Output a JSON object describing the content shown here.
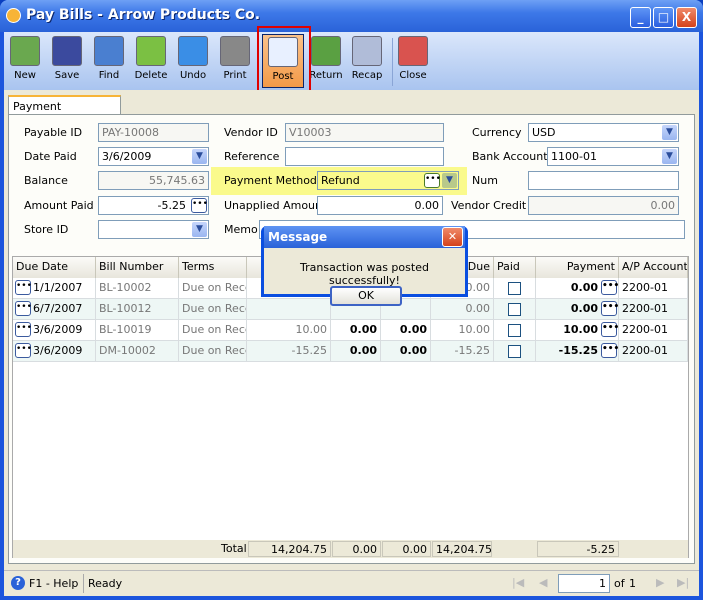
{
  "window": {
    "title": "Pay Bills - Arrow Products Co.",
    "controls": [
      "_",
      "□",
      "X"
    ]
  },
  "toolbar": [
    {
      "label": "New",
      "icon": "new-icon"
    },
    {
      "label": "Save",
      "icon": "save-icon"
    },
    {
      "label": "Find",
      "icon": "find-icon"
    },
    {
      "label": "Delete",
      "icon": "delete-icon"
    },
    {
      "label": "Undo",
      "icon": "undo-icon"
    },
    {
      "label": "Print",
      "icon": "print-icon"
    },
    {
      "label": "Post",
      "icon": "post-icon",
      "active": true
    },
    {
      "label": "Return",
      "icon": "return-icon"
    },
    {
      "label": "Recap",
      "icon": "recap-icon"
    },
    {
      "label": "Close",
      "icon": "close-icon"
    }
  ],
  "tab": "Payment Information",
  "form": {
    "payable_id": {
      "label": "Payable ID",
      "value": "PAY-10008"
    },
    "date_paid": {
      "label": "Date Paid",
      "value": "3/6/2009"
    },
    "balance": {
      "label": "Balance",
      "value": "55,745.63"
    },
    "amount_paid": {
      "label": "Amount Paid",
      "value": "-5.25"
    },
    "store_id": {
      "label": "Store ID",
      "value": ""
    },
    "vendor_id": {
      "label": "Vendor ID",
      "value": "V10003"
    },
    "reference": {
      "label": "Reference",
      "value": ""
    },
    "payment_method": {
      "label": "Payment Method",
      "value": "Refund"
    },
    "unapplied_amount": {
      "label": "Unapplied Amount",
      "value": "0.00"
    },
    "memo": {
      "label": "Memo",
      "value": ""
    },
    "currency": {
      "label": "Currency",
      "value": "USD"
    },
    "bank_account": {
      "label": "Bank Account",
      "value": "1100-01"
    },
    "num": {
      "label": "Num",
      "value": ""
    },
    "vendor_credit": {
      "label": "Vendor Credit",
      "value": "0.00"
    }
  },
  "grid": {
    "headers": [
      "Due Date",
      "Bill Number",
      "Terms",
      "",
      "",
      "",
      "Due",
      "Paid",
      "Payment",
      "A/P Account"
    ],
    "rows": [
      [
        "1/1/2007",
        "BL-10002",
        "Due on Rece",
        "",
        "",
        "",
        "0.00",
        false,
        "0.00",
        "2200-01"
      ],
      [
        "6/7/2007",
        "BL-10012",
        "Due on Rece",
        "",
        "",
        "",
        "0.00",
        false,
        "0.00",
        "2200-01"
      ],
      [
        "3/6/2009",
        "BL-10019",
        "Due on Rece",
        "10.00",
        "0.00",
        "0.00",
        "10.00",
        false,
        "10.00",
        "2200-01"
      ],
      [
        "3/6/2009",
        "DM-10002",
        "Due on Rece",
        "-15.25",
        "0.00",
        "0.00",
        "-15.25",
        false,
        "-15.25",
        "2200-01"
      ]
    ],
    "totals": {
      "label": "Total",
      "values": [
        "14,204.75",
        "0.00",
        "0.00",
        "14,204.75",
        "-5.25"
      ]
    }
  },
  "status": {
    "help": "F1 - Help",
    "text": "Ready",
    "page": "1",
    "of": "of",
    "total_pages": "1"
  },
  "dialog": {
    "title": "Message",
    "message": "Transaction was posted successfully!",
    "ok": "OK"
  },
  "colors": {
    "highlight": "#fafa8c",
    "post_outline": "#e00000",
    "titlebar": "#2a62d8"
  }
}
